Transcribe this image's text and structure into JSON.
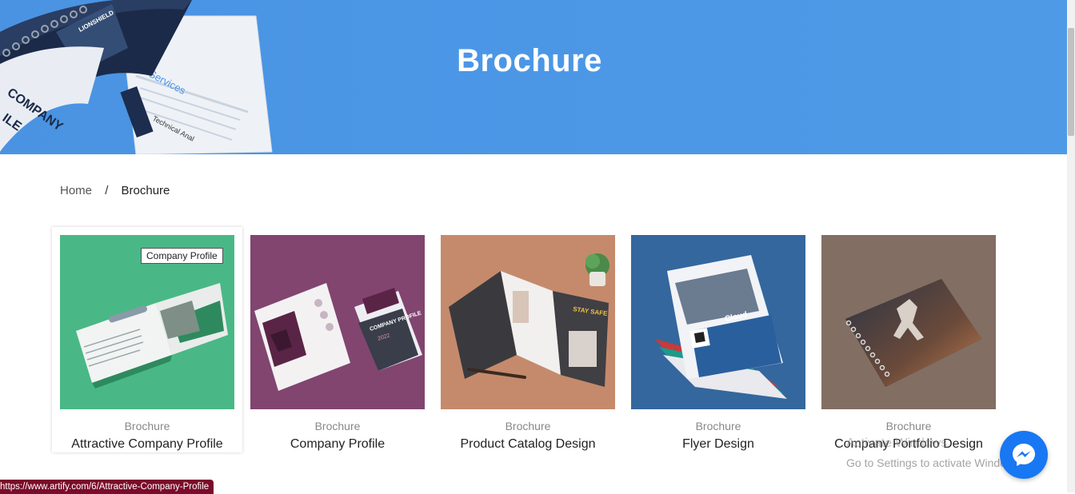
{
  "hero": {
    "title": "Brochure",
    "art_text_1": "Services",
    "art_text_2": "Technical Anal",
    "art_text_3": "COMPANY",
    "art_text_4": "ILE",
    "art_text_5": "LIONSHIELD"
  },
  "breadcrumb": {
    "home": "Home",
    "separator": "/",
    "current": "Brochure"
  },
  "cards": [
    {
      "category": "Brochure",
      "title": "Attractive Company Profile",
      "bg": "#3fb27f"
    },
    {
      "category": "Brochure",
      "title": "Company Profile",
      "bg": "#8a4a78"
    },
    {
      "category": "Brochure",
      "title": "Product Catalog Design",
      "bg": "#c58a6c"
    },
    {
      "category": "Brochure",
      "title": "Flyer Design",
      "bg": "#3a6ea5"
    },
    {
      "category": "Brochure",
      "title": "Company Portfolio Design",
      "bg": "#8a7468"
    }
  ],
  "thumb_text": {
    "company_profile": "COMPANY PROFILE",
    "year": "2022",
    "stay_safe": "STAY SAFE",
    "cloud": "Cloud"
  },
  "tooltip": "Company Profile",
  "status_url": "https://www.artify.com/6/Attractive-Company-Profile",
  "watermark": {
    "line1": "Activate Windows",
    "line2": "Go to Settings to activate Windows."
  },
  "icons": {
    "messenger": "messenger-icon"
  },
  "colors": {
    "hero_blue": "#4a93e2",
    "messenger_blue": "#1877f2",
    "status_bar": "#7a0b2a"
  }
}
